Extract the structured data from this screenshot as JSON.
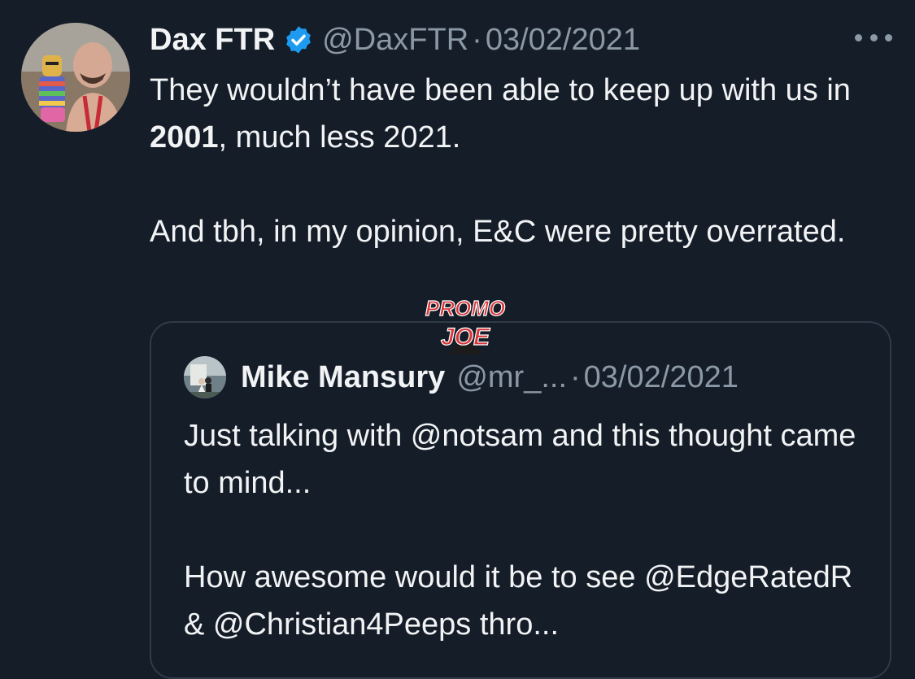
{
  "tweet": {
    "author_name": "Dax FTR",
    "handle": "@DaxFTR",
    "separator": "·",
    "date": "03/02/2021",
    "text_line1_pre": "They wouldn’t have been able to keep up with us in ",
    "text_line1_bold": "2001",
    "text_line1_post": ", much less 2021.",
    "text_para2": "And tbh, in my opinion, E&C were pretty overrated."
  },
  "watermark": {
    "line1": "PROMO",
    "line2": "JOE"
  },
  "quoted_tweet": {
    "author_name": "Mike Mansury",
    "handle": "@mr_...",
    "separator": "·",
    "date": "03/02/2021",
    "text_para1": "Just talking with @notsam and this thought came to mind...",
    "text_para2": "How awesome would it be to see @EdgeRatedR & @Christian4Peeps thro..."
  },
  "icons": {
    "verified": "verified-badge-icon",
    "more": "more-options-icon"
  },
  "colors": {
    "background": "#151d29",
    "verified_blue": "#1d9bf0",
    "secondary_text": "#8b98a5",
    "border": "#2f3b48"
  }
}
